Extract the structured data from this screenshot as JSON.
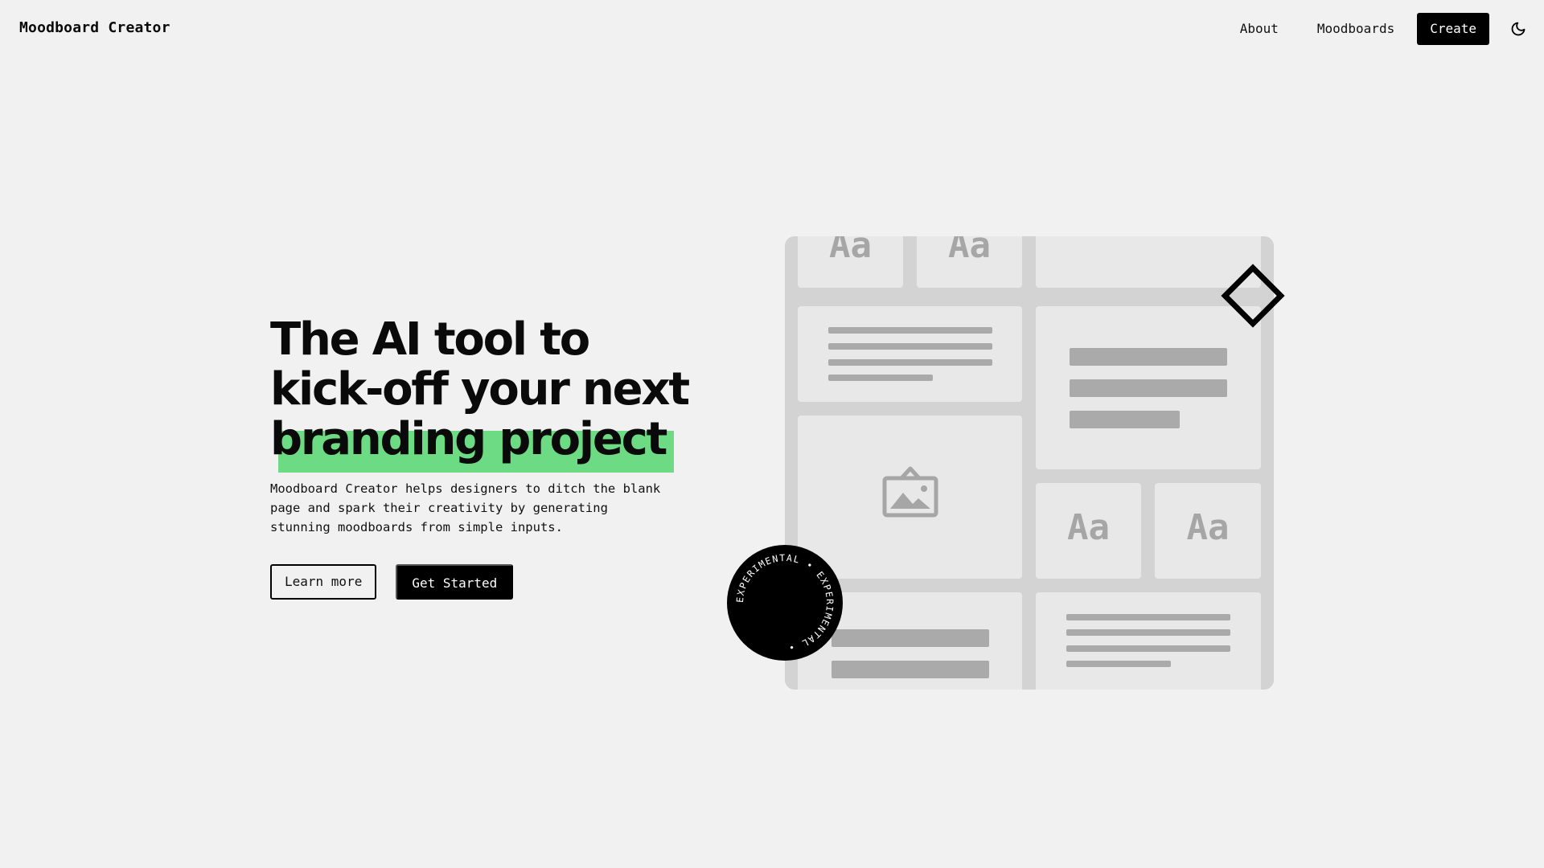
{
  "header": {
    "brand": "Moodboard Creator",
    "nav": {
      "about": "About",
      "moodboards": "Moodboards",
      "create": "Create"
    },
    "theme_icon": "moon-icon"
  },
  "hero": {
    "headline": [
      "The AI tool to",
      "kick-off your next",
      "branding project"
    ],
    "highlight_color": "#6ddb83",
    "description": "Moodboard Creator helps designers to ditch the blank page and spark their creativity by generating stunning moodboards from simple inputs.",
    "buttons": {
      "learn_more": "Learn more",
      "get_started": "Get Started"
    }
  },
  "illustration": {
    "type_sample": "Aa",
    "image_icon": "image-icon",
    "badge_text": "EXPERIMENTAL • EXPERIMENTAL • "
  }
}
